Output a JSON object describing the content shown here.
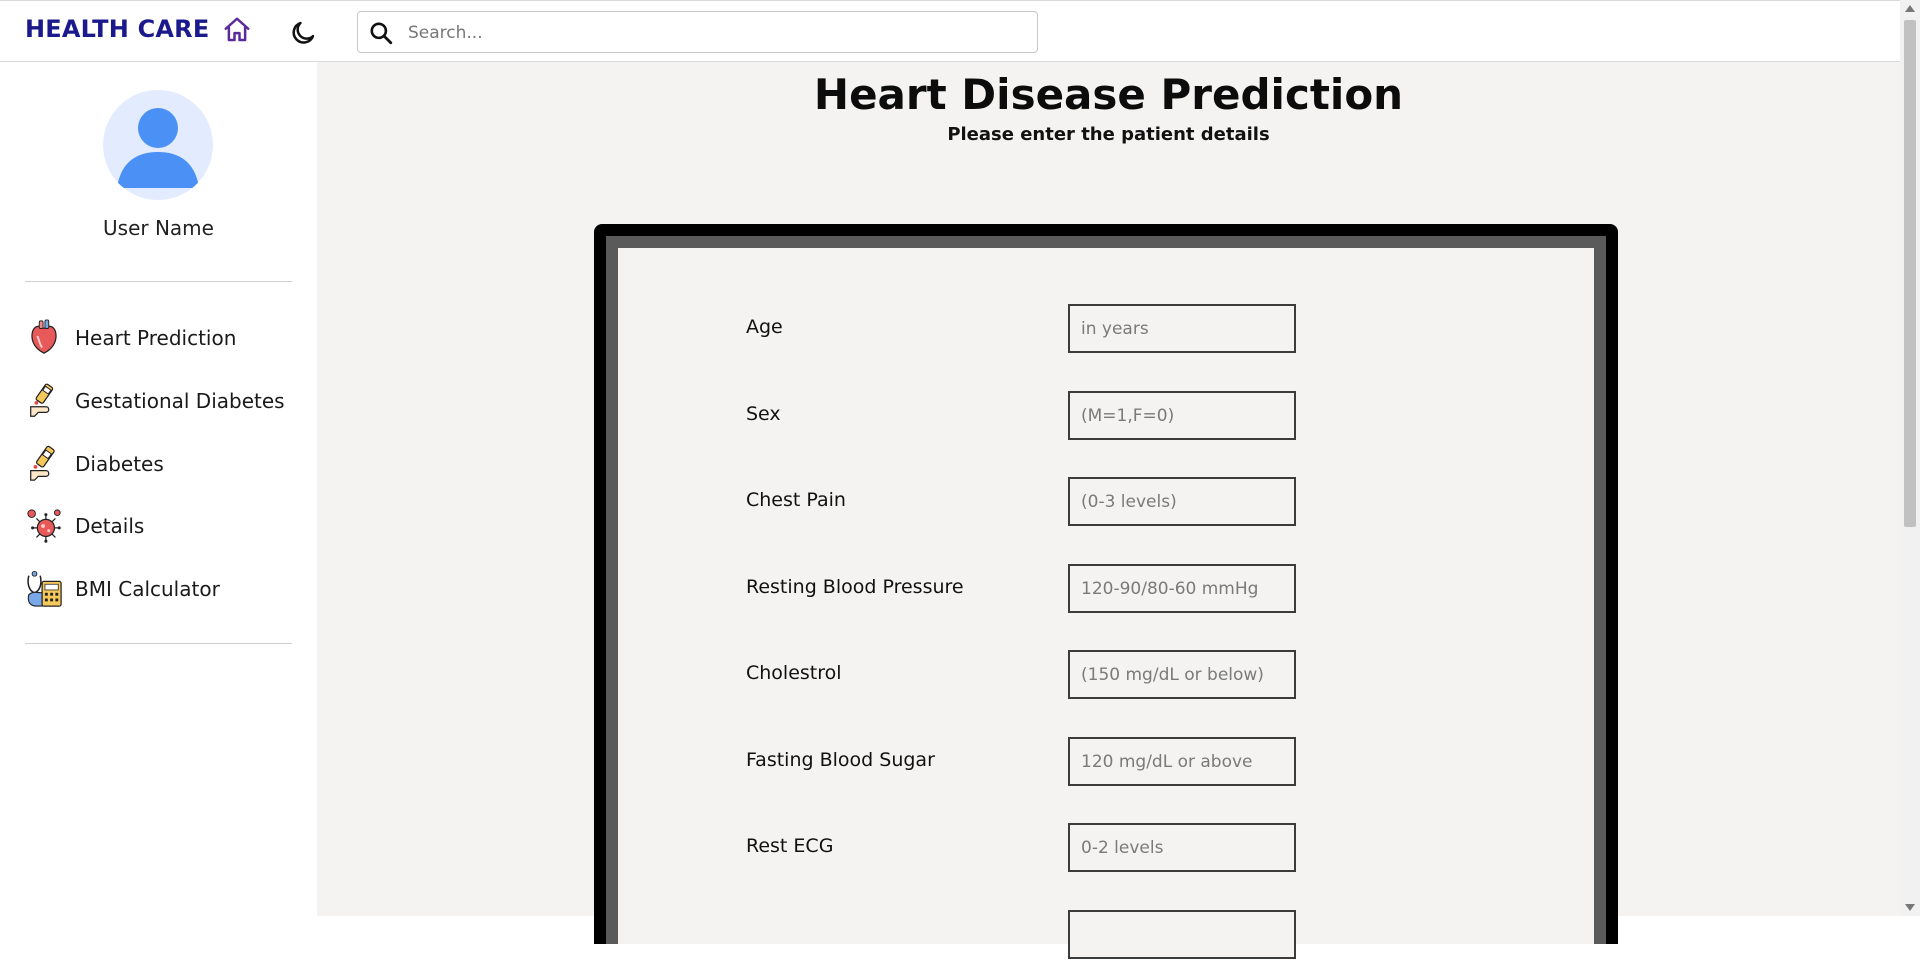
{
  "header": {
    "brand": "HEALTH CARE",
    "search_placeholder": "Search...",
    "icons": [
      "home-icon",
      "moon-icon",
      "search-icon"
    ]
  },
  "sidebar": {
    "username": "User Name",
    "items": [
      {
        "label": "Heart Prediction",
        "icon": "heart-icon"
      },
      {
        "label": "Gestational Diabetes",
        "icon": "glucose-test-icon"
      },
      {
        "label": "Diabetes",
        "icon": "insulin-pen-icon"
      },
      {
        "label": "Details",
        "icon": "virus-icon"
      },
      {
        "label": "BMI Calculator",
        "icon": "bmi-calculator-icon"
      }
    ]
  },
  "main": {
    "title": "Heart Disease Prediction",
    "subtitle": "Please enter the patient details",
    "fields": [
      {
        "label": "Age",
        "placeholder": "in years"
      },
      {
        "label": "Sex",
        "placeholder": "(M=1,F=0)"
      },
      {
        "label": "Chest Pain",
        "placeholder": "(0-3 levels)"
      },
      {
        "label": "Resting Blood Pressure",
        "placeholder": "120-90/80-60 mmHg"
      },
      {
        "label": "Cholestrol",
        "placeholder": "(150 mg/dL or below)"
      },
      {
        "label": "Fasting Blood Sugar",
        "placeholder": "120 mg/dL or above"
      },
      {
        "label": "Rest ECG",
        "placeholder": "0-2 levels"
      }
    ]
  },
  "colors": {
    "brand": "#1a1a8c",
    "home_icon": "#5b2a9a",
    "avatar_bg": "#e3ecff",
    "avatar_fg": "#4a90f5",
    "main_bg": "#f4f3f2"
  }
}
